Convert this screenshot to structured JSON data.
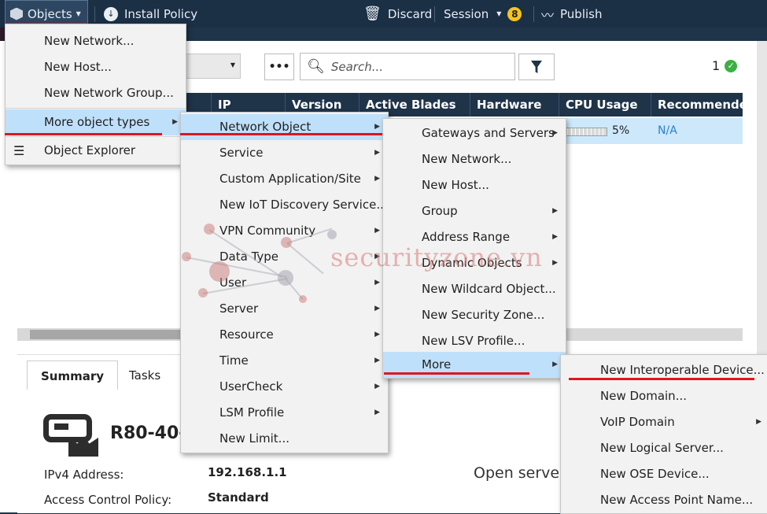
{
  "toolbar": {
    "objects": "Objects",
    "install_policy": "Install Policy",
    "discard": "Discard",
    "session": "Session",
    "session_badge": "8",
    "publish": "Publish"
  },
  "filterbar": {
    "more": "•••",
    "search_placeholder": "Search...",
    "count": "1"
  },
  "table": {
    "headers": [
      "IP",
      "Version",
      "Active Blades",
      "Hardware",
      "CPU Usage",
      "Recommende"
    ],
    "row": {
      "cpu": "5%",
      "recommended": "N/A"
    }
  },
  "lower": {
    "tab_summary": "Summary",
    "tab_tasks": "Tasks",
    "gateway_name": "R80-40-",
    "ipv4_label": "IPv4 Address:",
    "ipv4_value": "192.168.1.1",
    "acp_label": "Access Control Policy:",
    "acp_value": "Standard",
    "open_server": "Open server"
  },
  "menu1": {
    "items": [
      "New Network...",
      "New Host...",
      "New Network Group...",
      "More object types",
      "Object Explorer"
    ]
  },
  "menu2": {
    "items": [
      "Network Object",
      "Service",
      "Custom Application/Site",
      "New IoT Discovery Service...",
      "VPN Community",
      "Data Type",
      "User",
      "Server",
      "Resource",
      "Time",
      "UserCheck",
      "LSM Profile",
      "New Limit..."
    ]
  },
  "menu3": {
    "items": [
      "Gateways and Servers",
      "New Network...",
      "New Host...",
      "Group",
      "Address Range",
      "Dynamic Objects",
      "New Wildcard Object...",
      "New Security Zone...",
      "New LSV Profile...",
      "More"
    ]
  },
  "menu4": {
    "items": [
      "New Interoperable Device...",
      "New Domain...",
      "VoIP Domain",
      "New Logical Server...",
      "New OSE Device...",
      "New Access Point Name..."
    ]
  },
  "watermark": "securityzone.vn",
  "colors": {
    "toolbar_bg": "#1b2f45",
    "highlight": "#bfe0fb",
    "annotation_red": "#e0151f",
    "status_ok": "#3cb043",
    "badge": "#f5c518"
  }
}
